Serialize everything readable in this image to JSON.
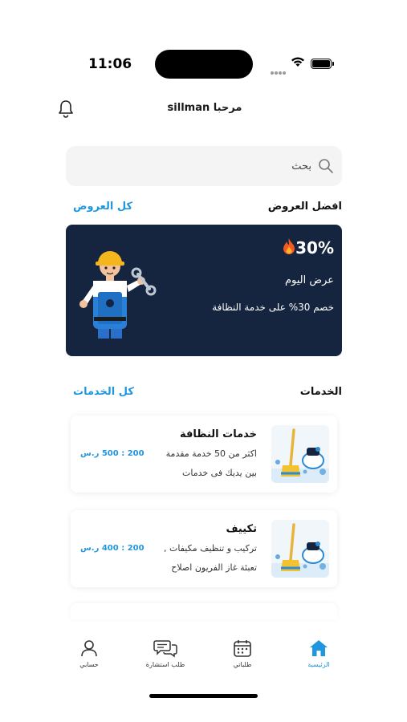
{
  "status_bar": {
    "time": "11:06"
  },
  "header": {
    "greeting": "مرحبا sillman"
  },
  "search": {
    "placeholder": "بحث"
  },
  "offers": {
    "title": "افضل العروض",
    "see_all": "كل العروض",
    "banner": {
      "percent": "30%",
      "line1": "عرض اليوم",
      "line2": "خصم 30% على خدمة النظافة",
      "background": "#15243f"
    }
  },
  "services": {
    "title": "الخدمات",
    "see_all": "كل الخدمات",
    "items": [
      {
        "title": "خدمات النظافة",
        "desc1": "اكثر من 50 خدمة مقدمة",
        "desc2": "بين يديك فى خدمات",
        "price": "200 : 500 ر.س",
        "icon": "cleaning-icon"
      },
      {
        "title": "تكييف",
        "desc1": "تركيب و تنظيف مكيفات ,",
        "desc2": "تعبئة غاز الفريون اصلاح",
        "price": "200 : 400 ر.س",
        "icon": "cleaning-icon"
      }
    ]
  },
  "nav": {
    "items": [
      {
        "label": "الرئيسية",
        "icon": "home-icon",
        "active": true
      },
      {
        "label": "طلباتي",
        "icon": "calendar-icon",
        "active": false
      },
      {
        "label": "طلب استشارة",
        "icon": "chat-icon",
        "active": false
      },
      {
        "label": "حسابي",
        "icon": "user-icon",
        "active": false
      }
    ]
  },
  "colors": {
    "accent": "#1f97e0",
    "banner": "#15243f",
    "active_nav": "#1f97e0"
  }
}
